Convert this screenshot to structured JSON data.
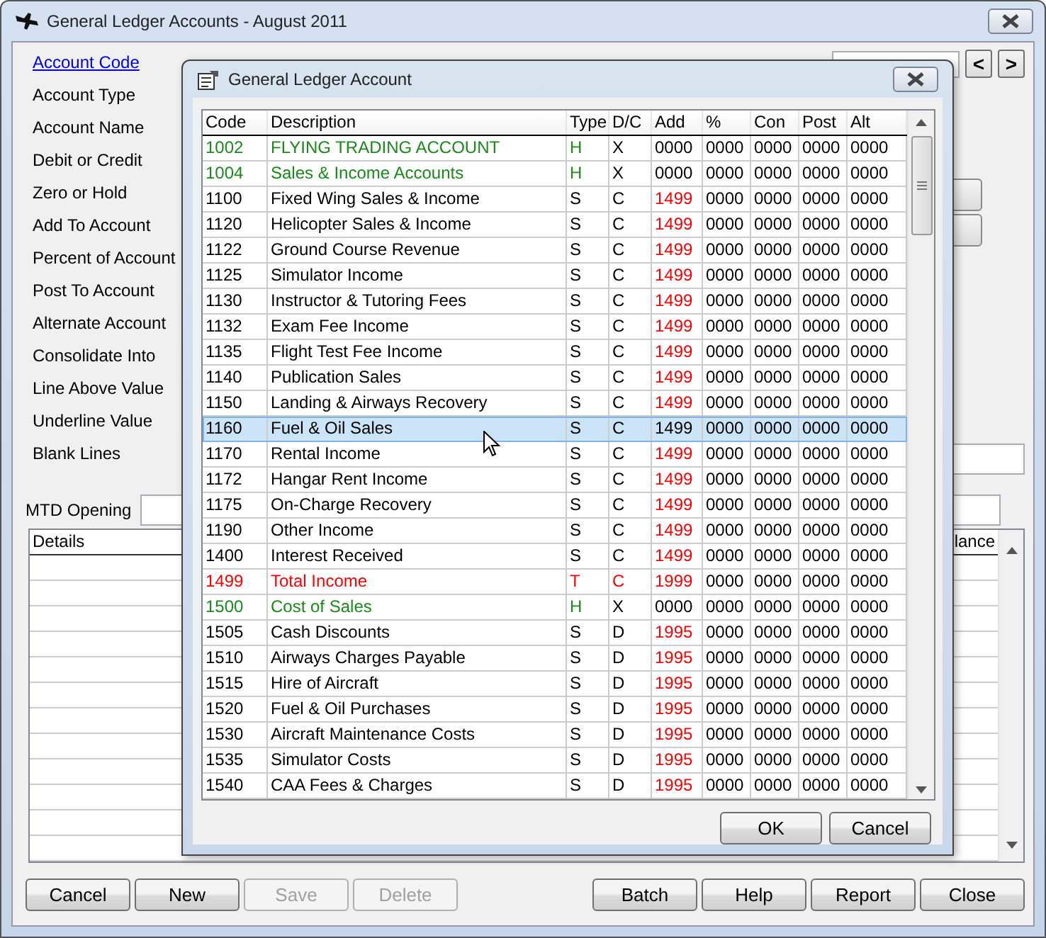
{
  "window": {
    "title": "General Ledger Accounts - August 2011"
  },
  "form": {
    "labels": [
      {
        "text": "Account Code",
        "kind": "link"
      },
      {
        "text": "Account Type",
        "kind": "plain"
      },
      {
        "text": "Account Name",
        "kind": "plain"
      },
      {
        "text": "Debit or Credit",
        "kind": "plain"
      },
      {
        "text": "Zero or Hold",
        "kind": "plain"
      },
      {
        "text": "Add To Account",
        "kind": "plain"
      },
      {
        "text": "Percent of Account",
        "kind": "plain"
      },
      {
        "text": "Post To Account",
        "kind": "plain"
      },
      {
        "text": "Alternate Account",
        "kind": "plain"
      },
      {
        "text": "Consolidate Into",
        "kind": "plain"
      },
      {
        "text": "Line Above Value",
        "kind": "plain"
      },
      {
        "text": "Underline Value",
        "kind": "plain"
      },
      {
        "text": "Blank Lines",
        "kind": "plain"
      }
    ],
    "nav_buttons": [
      "<",
      ">"
    ]
  },
  "mtd_opening": {
    "label": "MTD Opening"
  },
  "details_table": {
    "columns": [
      "Details",
      "lance"
    ]
  },
  "buttons": [
    {
      "label": "Cancel",
      "disabled": false
    },
    {
      "label": "New",
      "disabled": false
    },
    {
      "label": "Save",
      "disabled": true
    },
    {
      "label": "Delete",
      "disabled": true
    },
    {
      "label": "Batch",
      "disabled": false
    },
    {
      "label": "Help",
      "disabled": false
    },
    {
      "label": "Report",
      "disabled": false
    },
    {
      "label": "Close",
      "disabled": false
    }
  ],
  "dialog": {
    "title": "General Ledger Account",
    "columns": [
      "Code",
      "Description",
      "Type",
      "D/C",
      "Add",
      "%",
      "Con",
      "Post",
      "Alt"
    ],
    "rows": [
      {
        "kind": "heading",
        "selected": false,
        "cells": [
          "1002",
          "FLYING TRADING ACCOUNT",
          "H",
          "X",
          "0000",
          "0000",
          "0000",
          "0000",
          "0000"
        ]
      },
      {
        "kind": "heading",
        "selected": false,
        "cells": [
          "1004",
          "Sales & Income Accounts",
          "H",
          "X",
          "0000",
          "0000",
          "0000",
          "0000",
          "0000"
        ]
      },
      {
        "kind": "detail",
        "selected": false,
        "cells": [
          "1100",
          "Fixed Wing Sales & Income",
          "S",
          "C",
          "1499",
          "0000",
          "0000",
          "0000",
          "0000"
        ]
      },
      {
        "kind": "detail",
        "selected": false,
        "cells": [
          "1120",
          "Helicopter Sales & Income",
          "S",
          "C",
          "1499",
          "0000",
          "0000",
          "0000",
          "0000"
        ]
      },
      {
        "kind": "detail",
        "selected": false,
        "cells": [
          "1122",
          "Ground Course Revenue",
          "S",
          "C",
          "1499",
          "0000",
          "0000",
          "0000",
          "0000"
        ]
      },
      {
        "kind": "detail",
        "selected": false,
        "cells": [
          "1125",
          "Simulator Income",
          "S",
          "C",
          "1499",
          "0000",
          "0000",
          "0000",
          "0000"
        ]
      },
      {
        "kind": "detail",
        "selected": false,
        "cells": [
          "1130",
          "Instructor & Tutoring Fees",
          "S",
          "C",
          "1499",
          "0000",
          "0000",
          "0000",
          "0000"
        ]
      },
      {
        "kind": "detail",
        "selected": false,
        "cells": [
          "1132",
          "Exam Fee Income",
          "S",
          "C",
          "1499",
          "0000",
          "0000",
          "0000",
          "0000"
        ]
      },
      {
        "kind": "detail",
        "selected": false,
        "cells": [
          "1135",
          "Flight Test Fee Income",
          "S",
          "C",
          "1499",
          "0000",
          "0000",
          "0000",
          "0000"
        ]
      },
      {
        "kind": "detail",
        "selected": false,
        "cells": [
          "1140",
          "Publication Sales",
          "S",
          "C",
          "1499",
          "0000",
          "0000",
          "0000",
          "0000"
        ]
      },
      {
        "kind": "detail",
        "selected": false,
        "cells": [
          "1150",
          "Landing & Airways Recovery",
          "S",
          "C",
          "1499",
          "0000",
          "0000",
          "0000",
          "0000"
        ]
      },
      {
        "kind": "detail",
        "selected": true,
        "cells": [
          "1160",
          "Fuel & Oil Sales",
          "S",
          "C",
          "1499",
          "0000",
          "0000",
          "0000",
          "0000"
        ]
      },
      {
        "kind": "detail",
        "selected": false,
        "cells": [
          "1170",
          "Rental Income",
          "S",
          "C",
          "1499",
          "0000",
          "0000",
          "0000",
          "0000"
        ]
      },
      {
        "kind": "detail",
        "selected": false,
        "cells": [
          "1172",
          "Hangar Rent Income",
          "S",
          "C",
          "1499",
          "0000",
          "0000",
          "0000",
          "0000"
        ]
      },
      {
        "kind": "detail",
        "selected": false,
        "cells": [
          "1175",
          "On-Charge Recovery",
          "S",
          "C",
          "1499",
          "0000",
          "0000",
          "0000",
          "0000"
        ]
      },
      {
        "kind": "detail",
        "selected": false,
        "cells": [
          "1190",
          "Other Income",
          "S",
          "C",
          "1499",
          "0000",
          "0000",
          "0000",
          "0000"
        ]
      },
      {
        "kind": "detail",
        "selected": false,
        "cells": [
          "1400",
          "Interest Received",
          "S",
          "C",
          "1499",
          "0000",
          "0000",
          "0000",
          "0000"
        ]
      },
      {
        "kind": "total",
        "selected": false,
        "cells": [
          "1499",
          "Total Income",
          "T",
          "C",
          "1999",
          "0000",
          "0000",
          "0000",
          "0000"
        ]
      },
      {
        "kind": "heading",
        "selected": false,
        "cells": [
          "1500",
          "Cost of Sales",
          "H",
          "X",
          "0000",
          "0000",
          "0000",
          "0000",
          "0000"
        ]
      },
      {
        "kind": "detail",
        "selected": false,
        "cells": [
          "1505",
          "Cash Discounts",
          "S",
          "D",
          "1995",
          "0000",
          "0000",
          "0000",
          "0000"
        ]
      },
      {
        "kind": "detail",
        "selected": false,
        "cells": [
          "1510",
          "Airways Charges Payable",
          "S",
          "D",
          "1995",
          "0000",
          "0000",
          "0000",
          "0000"
        ]
      },
      {
        "kind": "detail",
        "selected": false,
        "cells": [
          "1515",
          "Hire of Aircraft",
          "S",
          "D",
          "1995",
          "0000",
          "0000",
          "0000",
          "0000"
        ]
      },
      {
        "kind": "detail",
        "selected": false,
        "cells": [
          "1520",
          "Fuel & Oil Purchases",
          "S",
          "D",
          "1995",
          "0000",
          "0000",
          "0000",
          "0000"
        ]
      },
      {
        "kind": "detail",
        "selected": false,
        "cells": [
          "1530",
          "Aircraft Maintenance Costs",
          "S",
          "D",
          "1995",
          "0000",
          "0000",
          "0000",
          "0000"
        ]
      },
      {
        "kind": "detail",
        "selected": false,
        "cells": [
          "1535",
          "Simulator Costs",
          "S",
          "D",
          "1995",
          "0000",
          "0000",
          "0000",
          "0000"
        ]
      },
      {
        "kind": "detail",
        "selected": false,
        "cells": [
          "1540",
          "CAA Fees & Charges",
          "S",
          "D",
          "1995",
          "0000",
          "0000",
          "0000",
          "0000"
        ]
      }
    ],
    "buttons": [
      {
        "label": "OK"
      },
      {
        "label": "Cancel"
      }
    ]
  }
}
